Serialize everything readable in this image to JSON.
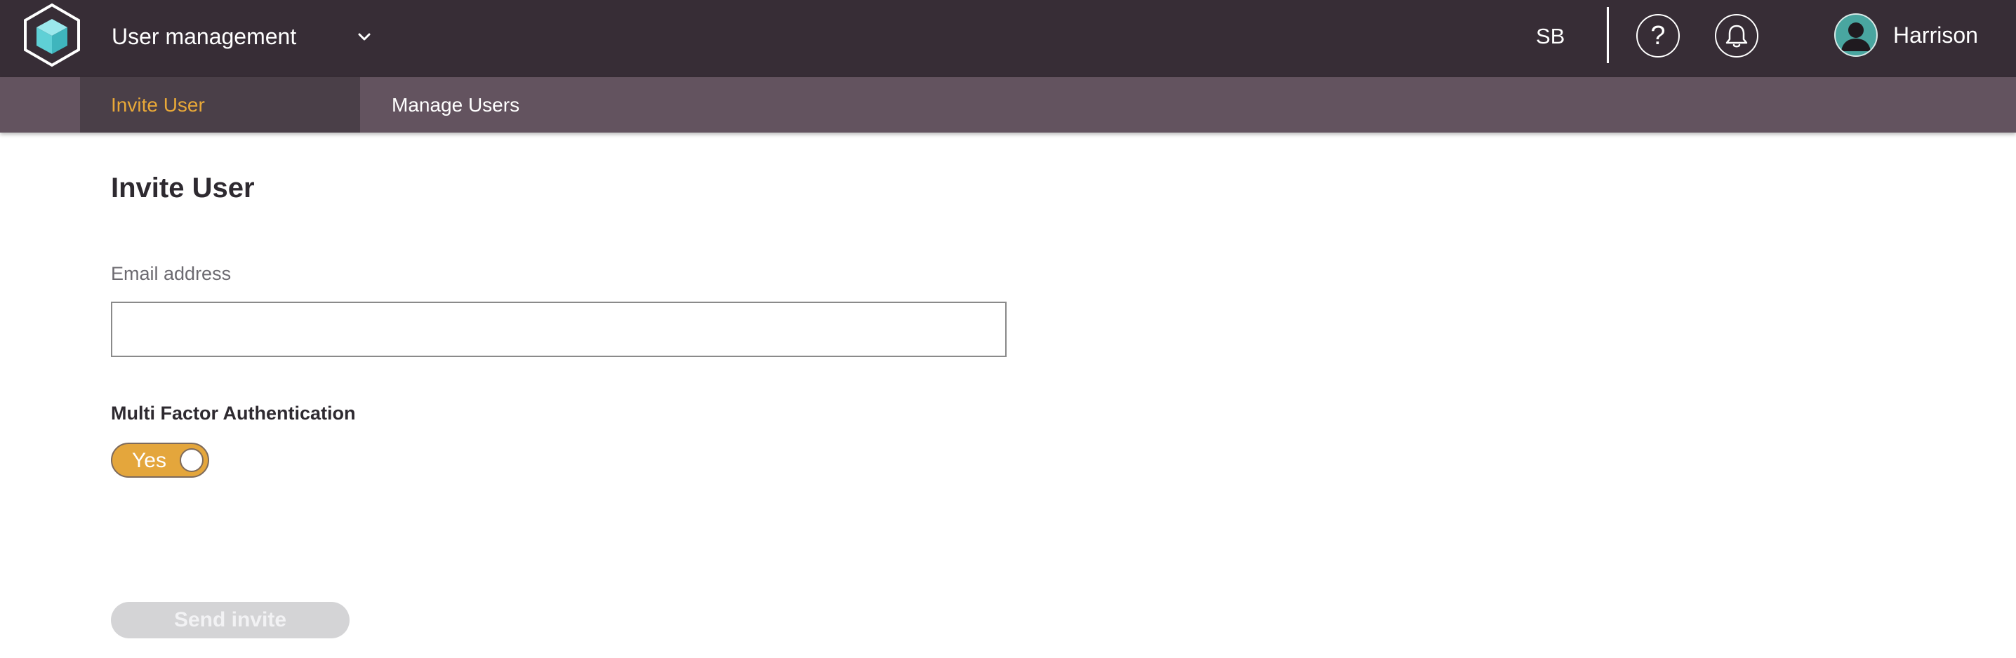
{
  "header": {
    "app_title": "User management",
    "initials": "SB",
    "help_glyph": "?",
    "user_name": "Harrison",
    "icons": {
      "logo": "cube-hexagon-logo",
      "dropdown": "chevron-down-icon",
      "help": "help-icon",
      "notifications": "bell-icon",
      "avatar": "user-avatar-icon"
    }
  },
  "tabs": [
    {
      "label": "Invite User",
      "active": true
    },
    {
      "label": "Manage Users",
      "active": false
    }
  ],
  "form": {
    "title": "Invite User",
    "email_label": "Email address",
    "email_value": "",
    "email_placeholder": "",
    "mfa_label": "Multi Factor Authentication",
    "mfa_toggle_label": "Yes",
    "mfa_enabled": true,
    "send_button_label": "Send invite",
    "send_button_enabled": false
  },
  "colors": {
    "header_bg": "#372d36",
    "tabbar_bg": "#63535f",
    "active_tab_bg": "#4a3f48",
    "accent": "#e8a838",
    "toggle_on": "#e4a63c",
    "disabled_button": "#d4d4d6",
    "logo_cube": "#5fd0d6"
  }
}
